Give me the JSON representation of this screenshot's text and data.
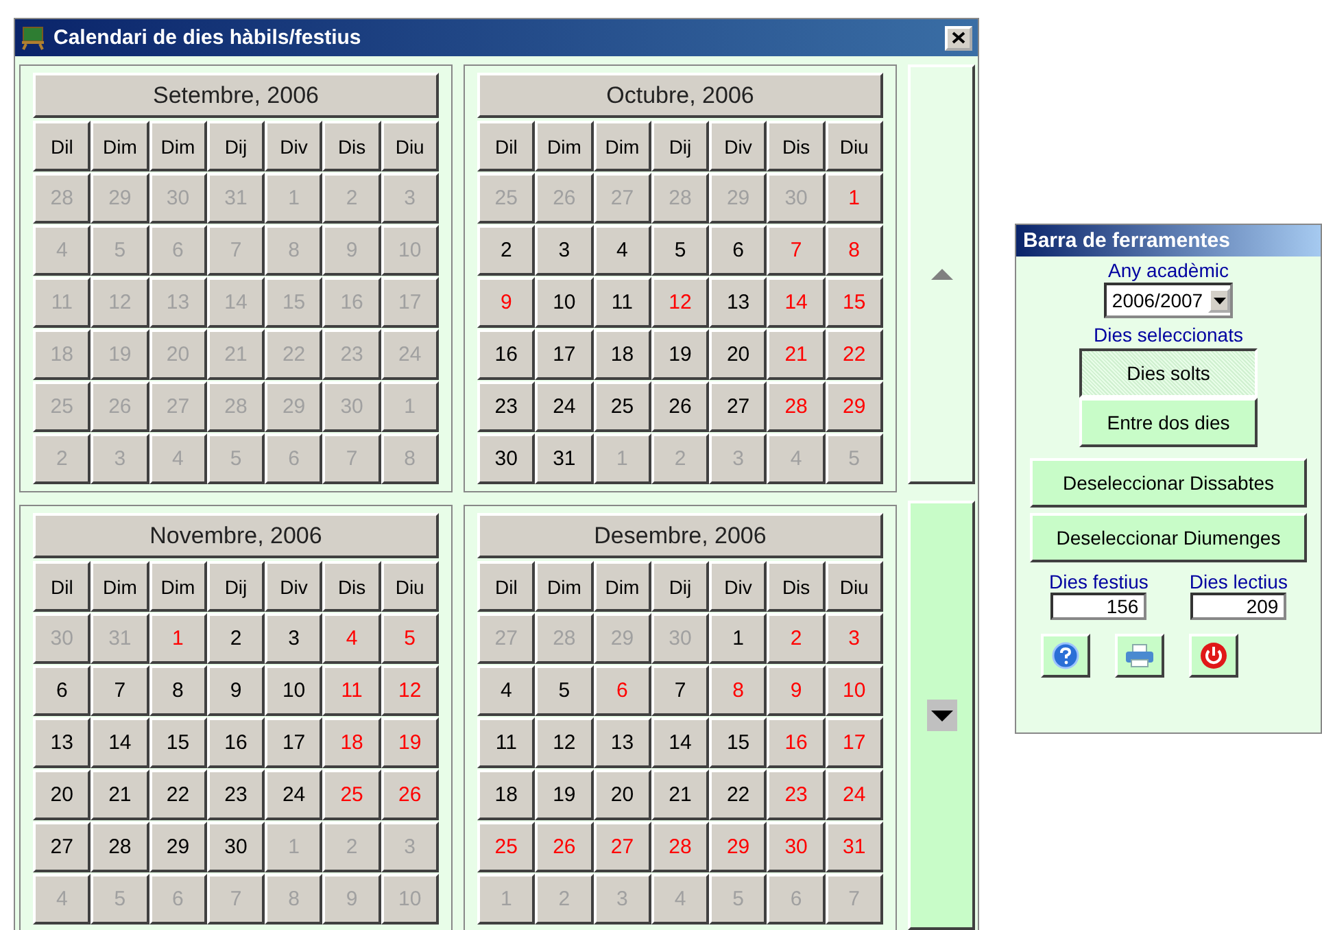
{
  "window": {
    "title": "Calendari de dies hàbils/festius"
  },
  "months": [
    {
      "title": "Setembre, 2006",
      "weekdays": [
        "Dil",
        "Dim",
        "Dim",
        "Dij",
        "Div",
        "Dis",
        "Diu"
      ],
      "weeks": [
        [
          {
            "day": "28",
            "kind": "other"
          },
          {
            "day": "29",
            "kind": "other"
          },
          {
            "day": "30",
            "kind": "other"
          },
          {
            "day": "31",
            "kind": "other"
          },
          {
            "day": "1",
            "kind": "other"
          },
          {
            "day": "2",
            "kind": "other"
          },
          {
            "day": "3",
            "kind": "other"
          }
        ],
        [
          {
            "day": "4",
            "kind": "other"
          },
          {
            "day": "5",
            "kind": "other"
          },
          {
            "day": "6",
            "kind": "other"
          },
          {
            "day": "7",
            "kind": "other"
          },
          {
            "day": "8",
            "kind": "other"
          },
          {
            "day": "9",
            "kind": "other"
          },
          {
            "day": "10",
            "kind": "other"
          }
        ],
        [
          {
            "day": "11",
            "kind": "other"
          },
          {
            "day": "12",
            "kind": "other"
          },
          {
            "day": "13",
            "kind": "other"
          },
          {
            "day": "14",
            "kind": "other"
          },
          {
            "day": "15",
            "kind": "other"
          },
          {
            "day": "16",
            "kind": "other"
          },
          {
            "day": "17",
            "kind": "other"
          }
        ],
        [
          {
            "day": "18",
            "kind": "other"
          },
          {
            "day": "19",
            "kind": "other"
          },
          {
            "day": "20",
            "kind": "other"
          },
          {
            "day": "21",
            "kind": "other"
          },
          {
            "day": "22",
            "kind": "other"
          },
          {
            "day": "23",
            "kind": "other"
          },
          {
            "day": "24",
            "kind": "other"
          }
        ],
        [
          {
            "day": "25",
            "kind": "other"
          },
          {
            "day": "26",
            "kind": "other"
          },
          {
            "day": "27",
            "kind": "other"
          },
          {
            "day": "28",
            "kind": "other"
          },
          {
            "day": "29",
            "kind": "other"
          },
          {
            "day": "30",
            "kind": "other"
          },
          {
            "day": "1",
            "kind": "other"
          }
        ],
        [
          {
            "day": "2",
            "kind": "other"
          },
          {
            "day": "3",
            "kind": "other"
          },
          {
            "day": "4",
            "kind": "other"
          },
          {
            "day": "5",
            "kind": "other"
          },
          {
            "day": "6",
            "kind": "other"
          },
          {
            "day": "7",
            "kind": "other"
          },
          {
            "day": "8",
            "kind": "other"
          }
        ]
      ]
    },
    {
      "title": "Octubre, 2006",
      "weekdays": [
        "Dil",
        "Dim",
        "Dim",
        "Dij",
        "Div",
        "Dis",
        "Diu"
      ],
      "weeks": [
        [
          {
            "day": "25",
            "kind": "other"
          },
          {
            "day": "26",
            "kind": "other"
          },
          {
            "day": "27",
            "kind": "other"
          },
          {
            "day": "28",
            "kind": "other"
          },
          {
            "day": "29",
            "kind": "other"
          },
          {
            "day": "30",
            "kind": "other"
          },
          {
            "day": "1",
            "kind": "holiday"
          }
        ],
        [
          {
            "day": "2",
            "kind": "work"
          },
          {
            "day": "3",
            "kind": "work"
          },
          {
            "day": "4",
            "kind": "work"
          },
          {
            "day": "5",
            "kind": "work"
          },
          {
            "day": "6",
            "kind": "work"
          },
          {
            "day": "7",
            "kind": "holiday"
          },
          {
            "day": "8",
            "kind": "holiday"
          }
        ],
        [
          {
            "day": "9",
            "kind": "holiday"
          },
          {
            "day": "10",
            "kind": "work"
          },
          {
            "day": "11",
            "kind": "work"
          },
          {
            "day": "12",
            "kind": "holiday"
          },
          {
            "day": "13",
            "kind": "work"
          },
          {
            "day": "14",
            "kind": "holiday"
          },
          {
            "day": "15",
            "kind": "holiday"
          }
        ],
        [
          {
            "day": "16",
            "kind": "work"
          },
          {
            "day": "17",
            "kind": "work"
          },
          {
            "day": "18",
            "kind": "work"
          },
          {
            "day": "19",
            "kind": "work"
          },
          {
            "day": "20",
            "kind": "work"
          },
          {
            "day": "21",
            "kind": "holiday"
          },
          {
            "day": "22",
            "kind": "holiday"
          }
        ],
        [
          {
            "day": "23",
            "kind": "work"
          },
          {
            "day": "24",
            "kind": "work"
          },
          {
            "day": "25",
            "kind": "work"
          },
          {
            "day": "26",
            "kind": "work"
          },
          {
            "day": "27",
            "kind": "work"
          },
          {
            "day": "28",
            "kind": "holiday"
          },
          {
            "day": "29",
            "kind": "holiday"
          }
        ],
        [
          {
            "day": "30",
            "kind": "work"
          },
          {
            "day": "31",
            "kind": "work"
          },
          {
            "day": "1",
            "kind": "other"
          },
          {
            "day": "2",
            "kind": "other"
          },
          {
            "day": "3",
            "kind": "other"
          },
          {
            "day": "4",
            "kind": "other"
          },
          {
            "day": "5",
            "kind": "other"
          }
        ]
      ]
    },
    {
      "title": "Novembre, 2006",
      "weekdays": [
        "Dil",
        "Dim",
        "Dim",
        "Dij",
        "Div",
        "Dis",
        "Diu"
      ],
      "weeks": [
        [
          {
            "day": "30",
            "kind": "other"
          },
          {
            "day": "31",
            "kind": "other"
          },
          {
            "day": "1",
            "kind": "holiday"
          },
          {
            "day": "2",
            "kind": "work"
          },
          {
            "day": "3",
            "kind": "work"
          },
          {
            "day": "4",
            "kind": "holiday"
          },
          {
            "day": "5",
            "kind": "holiday"
          }
        ],
        [
          {
            "day": "6",
            "kind": "work"
          },
          {
            "day": "7",
            "kind": "work"
          },
          {
            "day": "8",
            "kind": "work"
          },
          {
            "day": "9",
            "kind": "work"
          },
          {
            "day": "10",
            "kind": "work"
          },
          {
            "day": "11",
            "kind": "holiday"
          },
          {
            "day": "12",
            "kind": "holiday"
          }
        ],
        [
          {
            "day": "13",
            "kind": "work"
          },
          {
            "day": "14",
            "kind": "work"
          },
          {
            "day": "15",
            "kind": "work"
          },
          {
            "day": "16",
            "kind": "work"
          },
          {
            "day": "17",
            "kind": "work"
          },
          {
            "day": "18",
            "kind": "holiday"
          },
          {
            "day": "19",
            "kind": "holiday"
          }
        ],
        [
          {
            "day": "20",
            "kind": "work"
          },
          {
            "day": "21",
            "kind": "work"
          },
          {
            "day": "22",
            "kind": "work"
          },
          {
            "day": "23",
            "kind": "work"
          },
          {
            "day": "24",
            "kind": "work"
          },
          {
            "day": "25",
            "kind": "holiday"
          },
          {
            "day": "26",
            "kind": "holiday"
          }
        ],
        [
          {
            "day": "27",
            "kind": "work"
          },
          {
            "day": "28",
            "kind": "work"
          },
          {
            "day": "29",
            "kind": "work"
          },
          {
            "day": "30",
            "kind": "work"
          },
          {
            "day": "1",
            "kind": "other"
          },
          {
            "day": "2",
            "kind": "other"
          },
          {
            "day": "3",
            "kind": "other"
          }
        ],
        [
          {
            "day": "4",
            "kind": "other"
          },
          {
            "day": "5",
            "kind": "other"
          },
          {
            "day": "6",
            "kind": "other"
          },
          {
            "day": "7",
            "kind": "other"
          },
          {
            "day": "8",
            "kind": "other"
          },
          {
            "day": "9",
            "kind": "other"
          },
          {
            "day": "10",
            "kind": "other"
          }
        ]
      ]
    },
    {
      "title": "Desembre, 2006",
      "weekdays": [
        "Dil",
        "Dim",
        "Dim",
        "Dij",
        "Div",
        "Dis",
        "Diu"
      ],
      "weeks": [
        [
          {
            "day": "27",
            "kind": "other"
          },
          {
            "day": "28",
            "kind": "other"
          },
          {
            "day": "29",
            "kind": "other"
          },
          {
            "day": "30",
            "kind": "other"
          },
          {
            "day": "1",
            "kind": "work"
          },
          {
            "day": "2",
            "kind": "holiday"
          },
          {
            "day": "3",
            "kind": "holiday"
          }
        ],
        [
          {
            "day": "4",
            "kind": "work"
          },
          {
            "day": "5",
            "kind": "work"
          },
          {
            "day": "6",
            "kind": "holiday"
          },
          {
            "day": "7",
            "kind": "work"
          },
          {
            "day": "8",
            "kind": "holiday"
          },
          {
            "day": "9",
            "kind": "holiday"
          },
          {
            "day": "10",
            "kind": "holiday"
          }
        ],
        [
          {
            "day": "11",
            "kind": "work"
          },
          {
            "day": "12",
            "kind": "work"
          },
          {
            "day": "13",
            "kind": "work"
          },
          {
            "day": "14",
            "kind": "work"
          },
          {
            "day": "15",
            "kind": "work"
          },
          {
            "day": "16",
            "kind": "holiday"
          },
          {
            "day": "17",
            "kind": "holiday"
          }
        ],
        [
          {
            "day": "18",
            "kind": "work"
          },
          {
            "day": "19",
            "kind": "work"
          },
          {
            "day": "20",
            "kind": "work"
          },
          {
            "day": "21",
            "kind": "work"
          },
          {
            "day": "22",
            "kind": "work"
          },
          {
            "day": "23",
            "kind": "holiday"
          },
          {
            "day": "24",
            "kind": "holiday"
          }
        ],
        [
          {
            "day": "25",
            "kind": "holiday"
          },
          {
            "day": "26",
            "kind": "holiday"
          },
          {
            "day": "27",
            "kind": "holiday"
          },
          {
            "day": "28",
            "kind": "holiday"
          },
          {
            "day": "29",
            "kind": "holiday"
          },
          {
            "day": "30",
            "kind": "holiday"
          },
          {
            "day": "31",
            "kind": "holiday"
          }
        ],
        [
          {
            "day": "1",
            "kind": "other"
          },
          {
            "day": "2",
            "kind": "other"
          },
          {
            "day": "3",
            "kind": "other"
          },
          {
            "day": "4",
            "kind": "other"
          },
          {
            "day": "5",
            "kind": "other"
          },
          {
            "day": "6",
            "kind": "other"
          },
          {
            "day": "7",
            "kind": "other"
          }
        ]
      ]
    }
  ],
  "toolbar": {
    "title": "Barra de ferramentes",
    "year_label": "Any acadèmic",
    "year_value": "2006/2007",
    "selection_label": "Dies seleccionats",
    "selection_modes": [
      {
        "label": "Dies solts",
        "selected": true
      },
      {
        "label": "Entre dos dies",
        "selected": false
      }
    ],
    "buttons": [
      "Deseleccionar Dissabtes",
      "Deseleccionar Diumenges"
    ],
    "counters": [
      {
        "label": "Dies festius",
        "value": "156"
      },
      {
        "label": "Dies lectius",
        "value": "209"
      }
    ]
  }
}
